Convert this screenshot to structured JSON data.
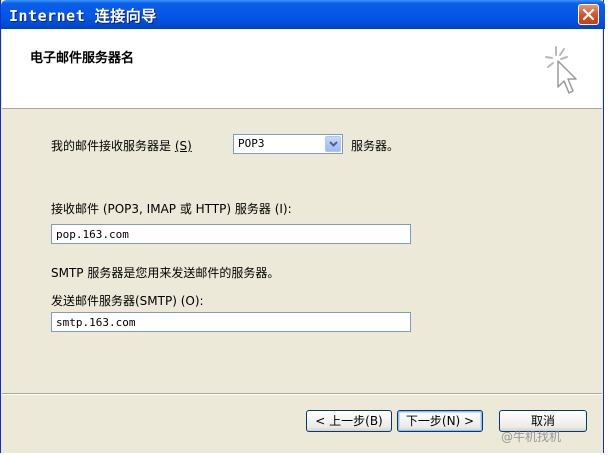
{
  "window": {
    "title": "Internet 连接向导"
  },
  "header": {
    "title": "电子邮件服务器名"
  },
  "form": {
    "server_type_label_pre": "我的邮件接收服务器是",
    "server_type_hotkey_text": "(S)",
    "server_type_value": "POP3",
    "server_type_suffix": "服务器。",
    "incoming_label": "接收邮件 (POP3, IMAP 或 HTTP) 服务器",
    "incoming_hotkey_text": "(I):",
    "incoming_value": "pop.163.com",
    "smtp_note": "SMTP 服务器是您用来发送邮件的服务器。",
    "outgoing_label": "发送邮件服务器(SMTP)",
    "outgoing_hotkey_text": "(O):",
    "outgoing_value": "smtp.163.com"
  },
  "buttons": {
    "back": "< 上一步(B)",
    "next": "下一步(N) >",
    "cancel": "取消"
  },
  "watermark": "@牛机找机"
}
